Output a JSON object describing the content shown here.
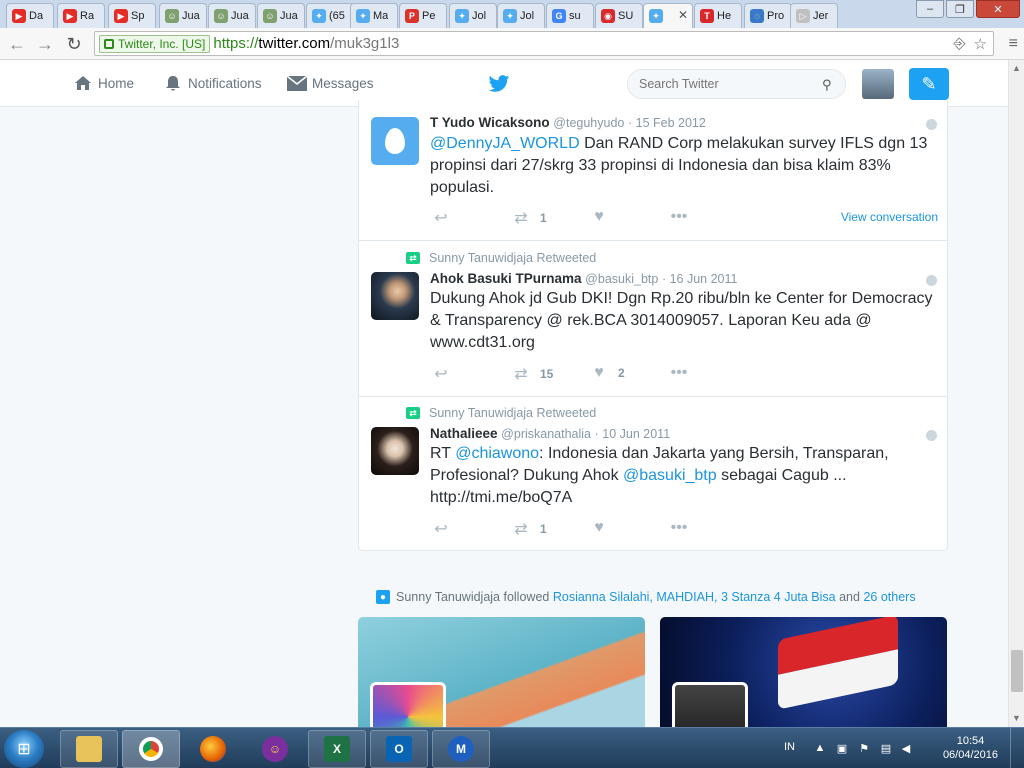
{
  "browser": {
    "tabs": [
      {
        "label": "Da",
        "fav_color": "#e52d27",
        "fav_glyph": "▶"
      },
      {
        "label": "Ra",
        "fav_color": "#e52d27",
        "fav_glyph": "▶"
      },
      {
        "label": "Sp",
        "fav_color": "#e52d27",
        "fav_glyph": "▶"
      },
      {
        "label": "Jua",
        "fav_color": "#7fa06f",
        "fav_glyph": "☺"
      },
      {
        "label": "Jua",
        "fav_color": "#7fa06f",
        "fav_glyph": "☺"
      },
      {
        "label": "Jua",
        "fav_color": "#7fa06f",
        "fav_glyph": "☺"
      },
      {
        "label": "(65",
        "fav_color": "#55acee",
        "fav_glyph": "✦"
      },
      {
        "label": "Ma",
        "fav_color": "#55acee",
        "fav_glyph": "✦"
      },
      {
        "label": "Pe",
        "fav_color": "#d9332b",
        "fav_glyph": "P"
      },
      {
        "label": "Jol",
        "fav_color": "#55acee",
        "fav_glyph": "✦"
      },
      {
        "label": "Jol",
        "fav_color": "#55acee",
        "fav_glyph": "✦"
      },
      {
        "label": "su",
        "fav_color": "#4285f4",
        "fav_glyph": "G"
      },
      {
        "label": "SU",
        "fav_color": "#d92b2b",
        "fav_glyph": "◉"
      },
      {
        "label": "",
        "fav_color": "#55acee",
        "fav_glyph": "✦",
        "active": true
      },
      {
        "label": "He",
        "fav_color": "#d9262b",
        "fav_glyph": "T"
      },
      {
        "label": "Pro",
        "fav_color": "#3a78c8",
        "fav_glyph": "◌"
      },
      {
        "label": "Jer",
        "fav_color": "#c0c0c0",
        "fav_glyph": "▷"
      }
    ],
    "ev_label": "Twitter, Inc. [US]",
    "url_scheme": "https://",
    "url_host": "twitter.com",
    "url_path": "/muk3g1l3"
  },
  "nav": {
    "home": "Home",
    "notifications": "Notifications",
    "messages": "Messages",
    "search_placeholder": "Search Twitter"
  },
  "tweets": [
    {
      "retweet_context": "",
      "name": "T Yudo Wicaksono",
      "handle": "@teguhyudo",
      "date": "· 15 Feb 2012",
      "text_parts": [
        {
          "t": "@DennyJA_WORLD",
          "link": true
        },
        {
          "t": " Dan RAND Corp melakukan survey IFLS dgn 13 propinsi dari 27/skrg 33 propinsi di Indonesia dan bisa klaim 83% populasi.",
          "link": false
        }
      ],
      "retweets": "1",
      "likes": "",
      "view_conversation": "View conversation"
    },
    {
      "retweet_context": "Sunny Tanuwidjaja Retweeted",
      "name": "Ahok Basuki TPurnama",
      "handle": "@basuki_btp",
      "date": "· 16 Jun 2011",
      "text_parts": [
        {
          "t": "Dukung Ahok jd Gub DKI! Dgn Rp.20 ribu/bln ke Center for Democracy & Transparency @ rek.BCA 3014009057. Laporan Keu ada @ www.cdt31.org",
          "link": false
        }
      ],
      "retweets": "15",
      "likes": "2",
      "view_conversation": ""
    },
    {
      "retweet_context": "Sunny Tanuwidjaja Retweeted",
      "name": "Nathalieee",
      "handle": "@priskanathalia",
      "date": "· 10 Jun 2011",
      "text_parts": [
        {
          "t": "RT ",
          "link": false
        },
        {
          "t": "@chiawono",
          "link": true
        },
        {
          "t": ": Indonesia dan Jakarta yang Bersih, Transparan, Profesional? Dukung Ahok ",
          "link": false
        },
        {
          "t": "@basuki_btp",
          "link": true
        },
        {
          "t": " sebagai Cagub ... http://tmi.me/boQ7A",
          "link": false
        }
      ],
      "retweets": "1",
      "likes": "",
      "view_conversation": ""
    }
  ],
  "followed": {
    "prefix": "Sunny Tanuwidjaja followed",
    "names": "Rosianna Silalahi, MAHDIAH, 3 Stanza 4 Juta Bisa",
    "and": "and",
    "others": "26 others"
  },
  "taskbar": {
    "lang": "IN",
    "time": "10:54",
    "date": "06/04/2016"
  },
  "colors": {
    "twitter_blue": "#1da1f2",
    "link_blue": "#1b95e0",
    "retweet_green": "#19cf86"
  }
}
